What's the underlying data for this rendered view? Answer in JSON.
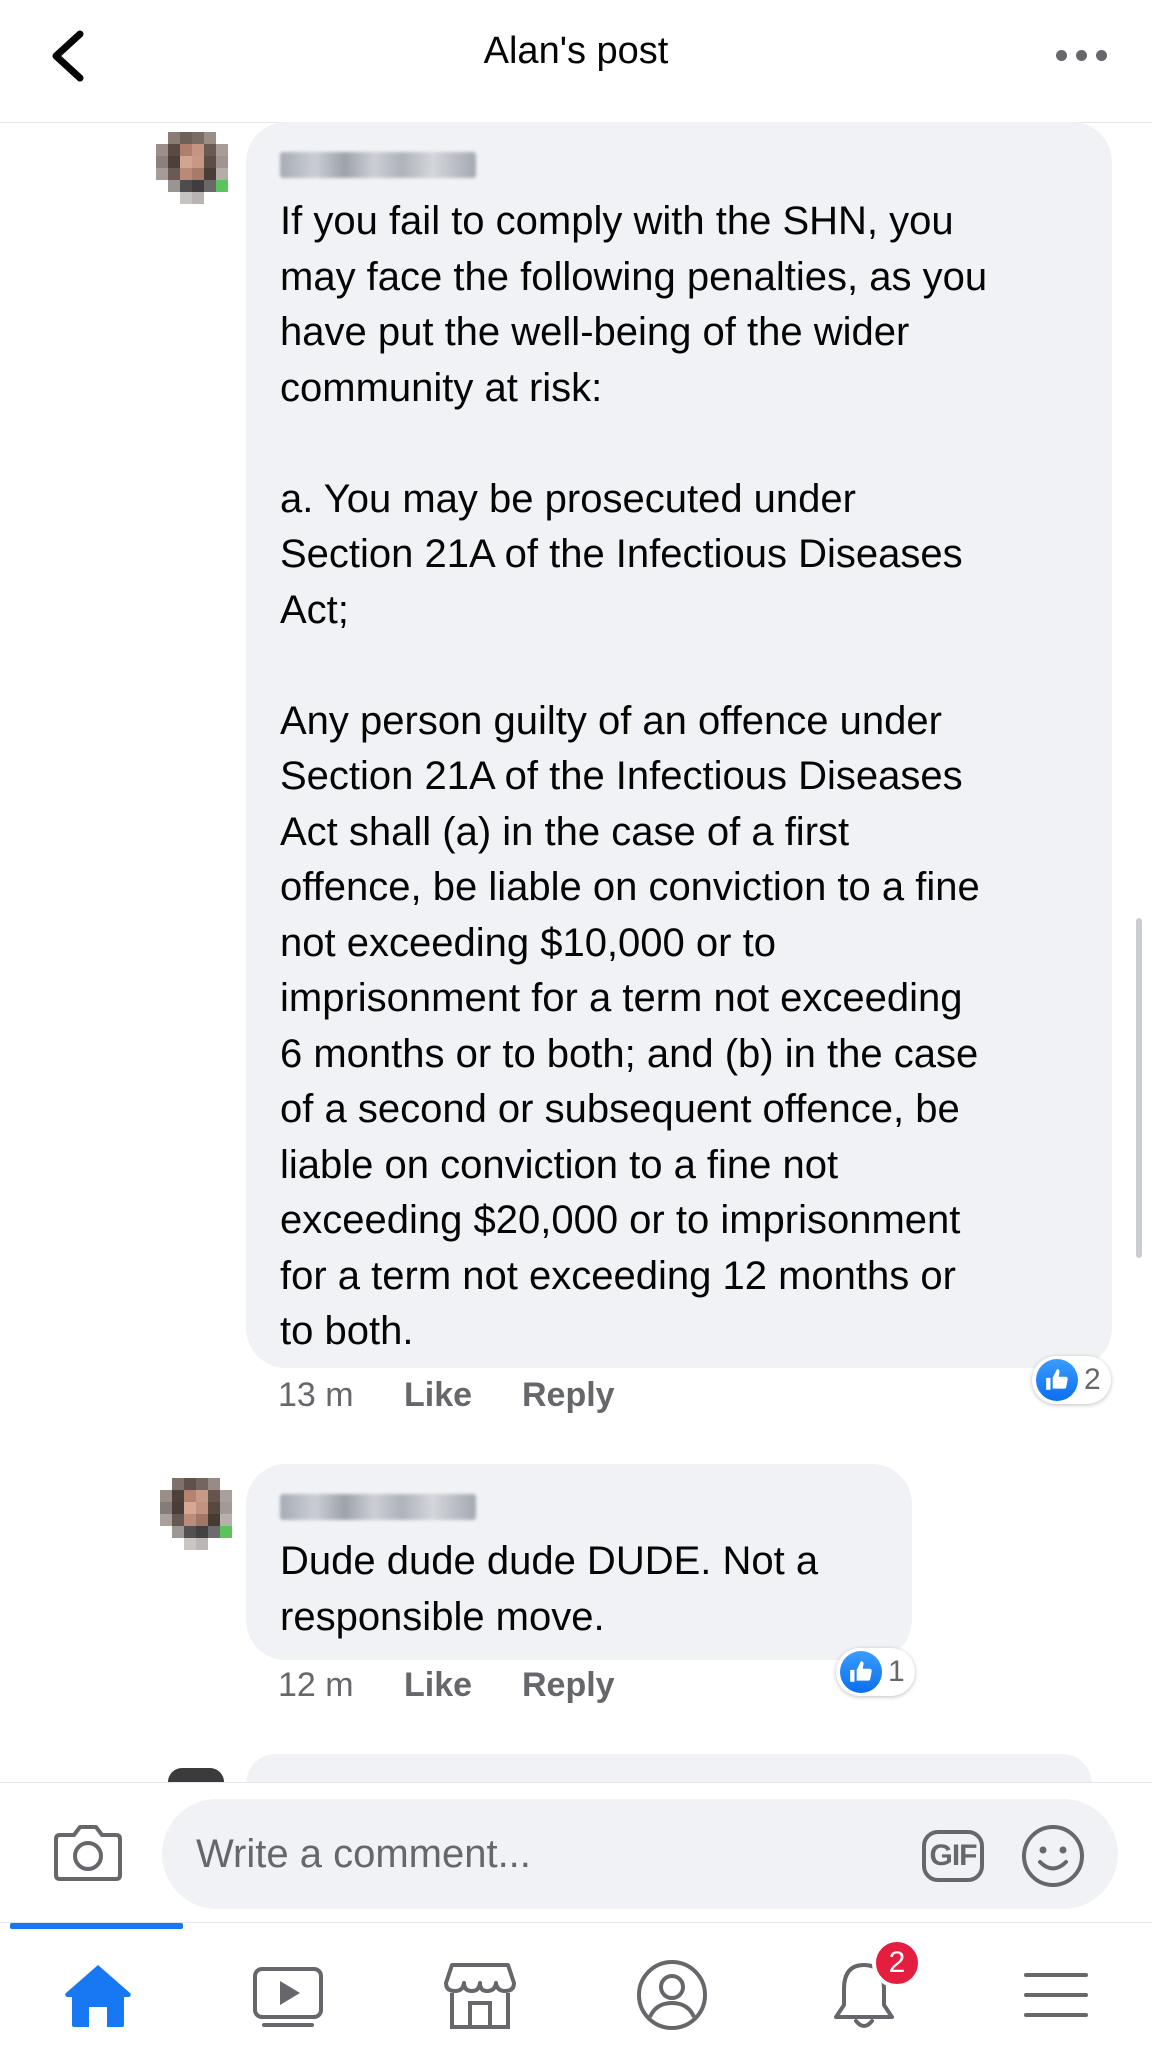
{
  "header": {
    "title": "Alan's post"
  },
  "comments": [
    {
      "text": "If you fail to comply with the SHN, you\nmay face the following penalties, as you\nhave put the well-being of the wider\ncommunity at risk:\n\na. You may be prosecuted under\nSection 21A of the Infectious Diseases\nAct;\n\nAny person guilty of an offence under\nSection 21A of the Infectious Diseases\nAct shall (a) in the case of a first\noffence, be liable on conviction to a fine\nnot exceeding $10,000 or to\nimprisonment for a term not exceeding\n6 months or to both; and (b) in the case\nof a second or subsequent offence, be\nliable on conviction to a fine not\nexceeding $20,000 or to imprisonment\nfor a term not exceeding 12 months or\nto both.",
      "time": "13 m",
      "like_label": "Like",
      "reply_label": "Reply",
      "reaction_count": "2"
    },
    {
      "text": "Dude dude dude DUDE. Not a\nresponsible move.",
      "time": "12 m",
      "like_label": "Like",
      "reply_label": "Reply",
      "reaction_count": "1"
    }
  ],
  "composer": {
    "placeholder": "Write a comment...",
    "gif_label": "GIF"
  },
  "nav": {
    "tabs": [
      "home-icon",
      "video-icon",
      "marketplace-icon",
      "profile-icon",
      "notifications-icon",
      "menu-icon"
    ],
    "active_tab": "home",
    "notifications_badge": "2"
  },
  "colors": {
    "brand": "#1877f2",
    "bubble": "#f0f2f5",
    "secondary_text": "#65676b",
    "badge": "#e41e3f"
  }
}
